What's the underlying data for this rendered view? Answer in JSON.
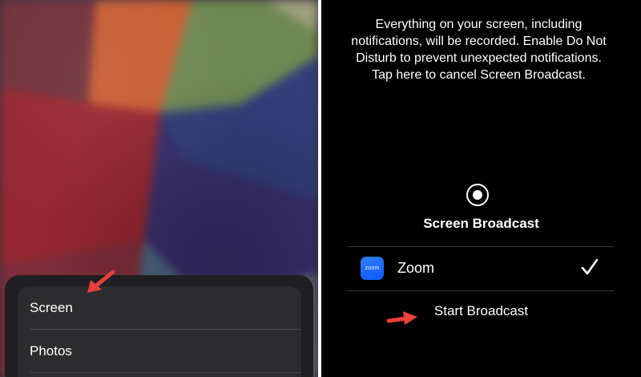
{
  "left": {
    "menu_items": [
      {
        "label": "Screen"
      },
      {
        "label": "Photos"
      }
    ]
  },
  "right": {
    "info_text": "Everything on your screen, including notifications, will be recorded. Enable Do Not Disturb to prevent unexpected notifications. Tap here to cancel Screen Broadcast.",
    "sheet_title": "Screen Broadcast",
    "app": {
      "icon_text": "zoom",
      "label": "Zoom",
      "selected": true
    },
    "start_button": "Start Broadcast"
  },
  "icons": {
    "record": "record-icon",
    "zoom": "zoom-app-icon",
    "selected": "checkmark-icon",
    "annotation": "arrow-icon"
  },
  "colors": {
    "dark_background": "#000000",
    "sheet_background": "#1f1f21",
    "menu_background": "#2c2c2e",
    "zoom_blue": "#0b5cff",
    "annotation_red": "#e8403a"
  }
}
